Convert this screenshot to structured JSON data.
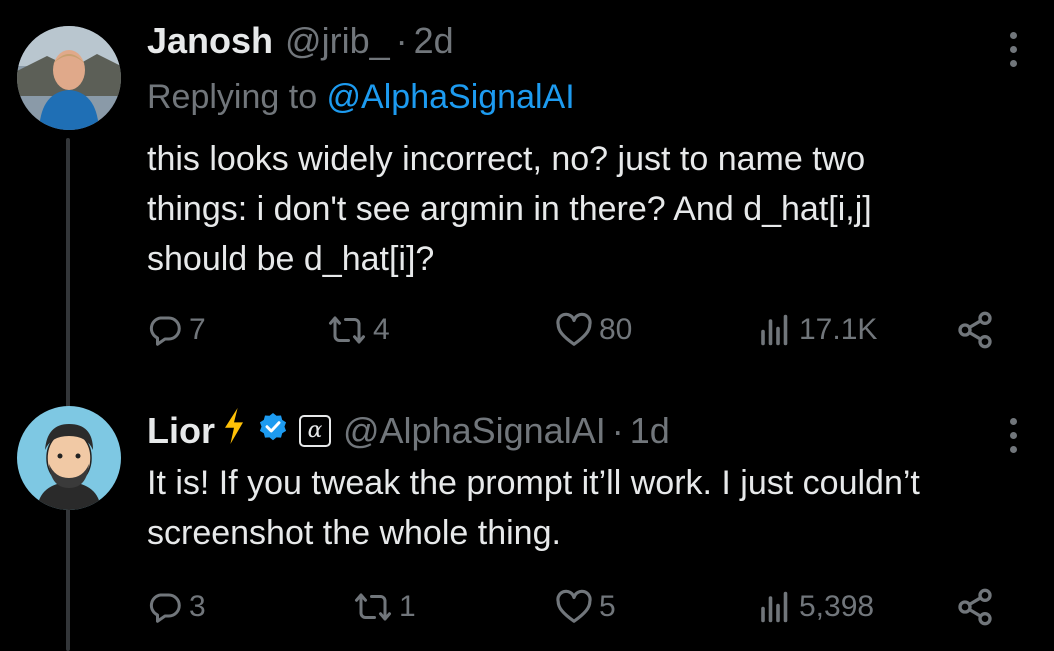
{
  "tweets": [
    {
      "name": "Janosh",
      "handle": "@jrib_",
      "dot": "·",
      "time": "2d",
      "replying_prefix": "Replying to ",
      "replying_mention": "@AlphaSignalAI",
      "lines": [
        "this looks widely incorrect, no? just to name two",
        "things: i don't see argmin in there? And d_hat[i,j]",
        "should be d_hat[i]?"
      ],
      "replies": "7",
      "retweets": "4",
      "likes": "80",
      "views": "17.1K"
    },
    {
      "name": "Lior",
      "handle": "@AlphaSignalAI",
      "dot": "·",
      "time": "1d",
      "affiliate_glyph": "α",
      "lines": [
        "It is! If you tweak the prompt it’ll work. I just couldn’t",
        "screenshot the whole thing."
      ],
      "replies": "3",
      "retweets": "1",
      "likes": "5",
      "views": "5,398"
    }
  ],
  "colors": {
    "background": "#000000",
    "text": "#e7e9ea",
    "muted": "#71767b",
    "accent": "#1d9bf0",
    "bolt": "#ffc107",
    "verified": "#1d9bf0"
  }
}
